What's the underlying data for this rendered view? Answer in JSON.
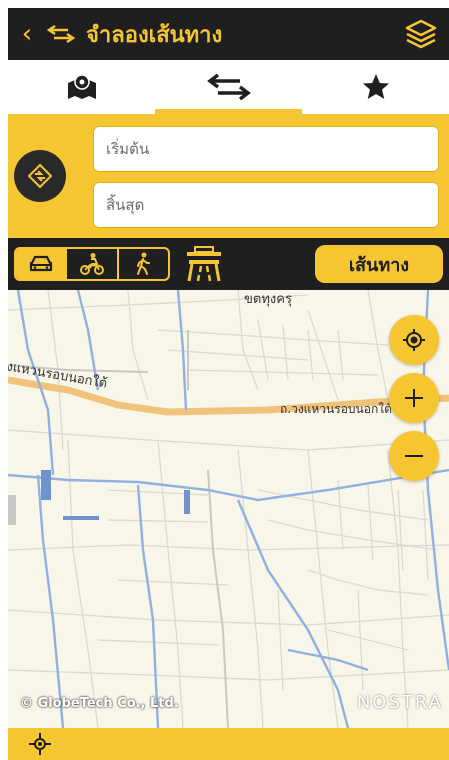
{
  "header": {
    "title": "จำลองเส้นทาง",
    "back_icon": "chevron-left-icon",
    "route_icon": "route-arrows-icon",
    "layers_icon": "layers-icon"
  },
  "tabs": [
    {
      "name": "map-pin",
      "icon": "map-pin-icon"
    },
    {
      "name": "route",
      "icon": "route-arrows-icon",
      "active": true
    },
    {
      "name": "favorites",
      "icon": "star-icon"
    }
  ],
  "inputs": {
    "start_placeholder": "เริ่มต้น",
    "end_placeholder": "สิ้นสุด"
  },
  "travel_modes": [
    {
      "name": "car",
      "icon": "car-icon",
      "active": true
    },
    {
      "name": "motorcycle",
      "icon": "motorcycle-icon",
      "active": false
    },
    {
      "name": "walk",
      "icon": "walk-icon",
      "active": false
    }
  ],
  "toll_icon": "tollway-icon",
  "route_button": "เส้นทาง",
  "map": {
    "label_top": "ขตทุงครุ",
    "road_left": "งแหวนรอบนอกใต้",
    "road_right": "ถ.วงแหวนรอบนอกใต้",
    "copyright": "© GlobeTech Co., Ltd.",
    "brand": "NOSTRA",
    "controls": [
      "locate-icon",
      "zoom-in-icon",
      "zoom-out-icon"
    ]
  },
  "bottom": {
    "gps_icon": "gps-icon"
  },
  "colors": {
    "accent": "#f6c532",
    "dark": "#1f1f1f"
  }
}
